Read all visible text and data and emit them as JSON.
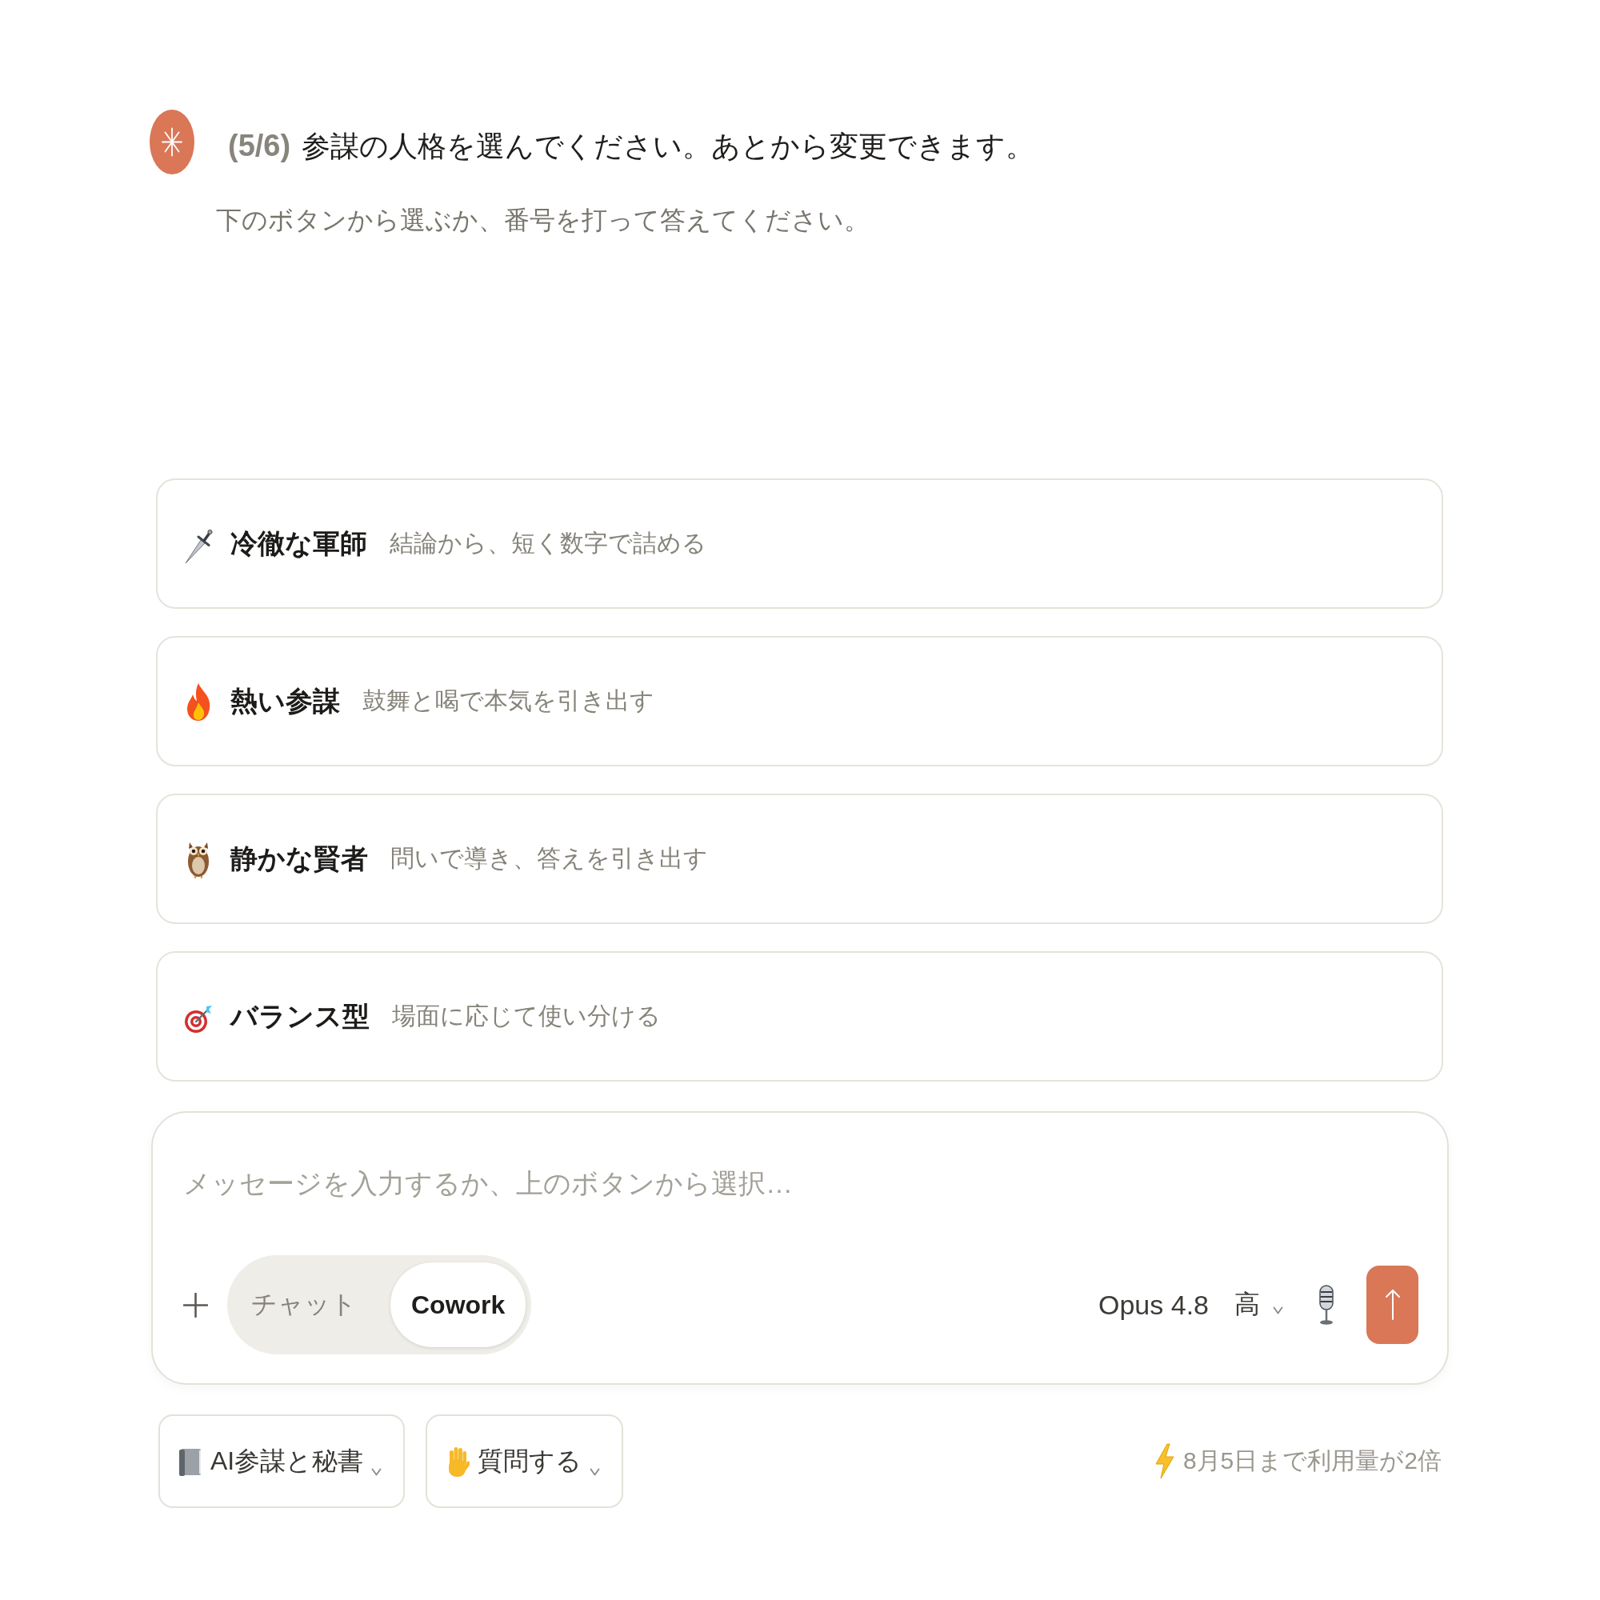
{
  "header": {
    "step": "(5/6)",
    "question": "参謀の人格を選んでください。あとから変更できます。",
    "hint": "下のボタンから選ぶか、番号を打って答えてください。"
  },
  "options": [
    {
      "title": "冷徹な軍師",
      "description": "結論から、短く数字で詰める"
    },
    {
      "title": "熱い参謀",
      "description": "鼓舞と喝で本気を引き出す"
    },
    {
      "title": "静かな賢者",
      "description": "問いで導き、答えを引き出す"
    },
    {
      "title": "バランス型",
      "description": "場面に応じて使い分ける"
    }
  ],
  "composer": {
    "placeholder": "メッセージを入力するか、上のボタンから選択…",
    "modes": [
      {
        "label": "チャット",
        "selected": false
      },
      {
        "label": "Cowork",
        "selected": true
      }
    ],
    "model": "Opus 4.8",
    "effort": "高"
  },
  "footer": {
    "buttons": [
      {
        "label": "AI参謀と秘書"
      },
      {
        "label": "質問する"
      }
    ],
    "notice": "8月5日まで利用量が2倍"
  }
}
